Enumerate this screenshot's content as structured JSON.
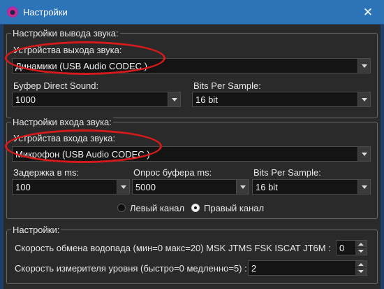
{
  "window": {
    "title": "Настройки",
    "close_glyph": "✕",
    "icon": "app-logo-icon"
  },
  "output": {
    "group_title": "Настройки вывода звука:",
    "device_label": "Устройства выхода звука:",
    "device_value": "Динамики (USB Audio CODEC )",
    "buffer_label": "Буфер Direct Sound:",
    "buffer_value": "1000",
    "bits_label": "Bits Per Sample:",
    "bits_value": "16 bit"
  },
  "input": {
    "group_title": "Настройки входа звука:",
    "device_label": "Устройства входа звука:",
    "device_value": "Микрофон (USB Audio CODEC )",
    "delay_label": "Задержка в ms:",
    "delay_value": "100",
    "poll_label": "Опрос буфера ms:",
    "poll_value": "5000",
    "bits_label": "Bits Per Sample:",
    "bits_value": "16 bit",
    "left_channel_label": "Левый канал",
    "right_channel_label": "Правый канал",
    "selected_channel": "right"
  },
  "settings": {
    "group_title": "Настройки:",
    "waterfall_label": "Скорость обмена водопада (мин=0 макс=20) MSK JTMS FSK ISCAT JT6M :",
    "waterfall_value": "0",
    "meter_label": "Скорость измерителя уровня (быстро=0 медленно=5) :",
    "meter_value": "2"
  },
  "colors": {
    "titlebar": "#2d73b8",
    "background": "#2a2a2a",
    "annotation": "#d41a1a"
  }
}
